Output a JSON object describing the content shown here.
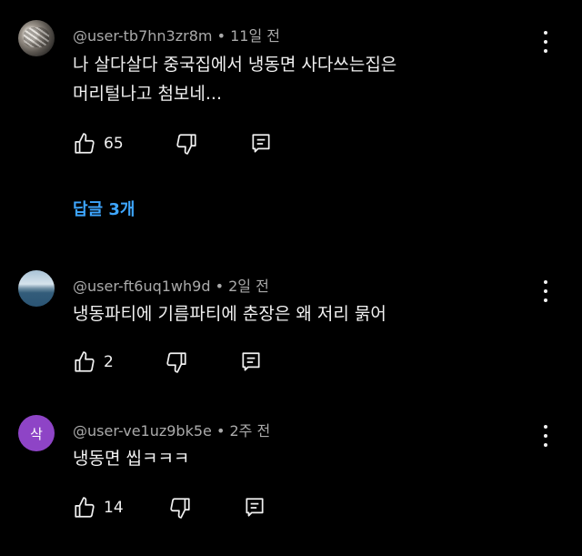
{
  "comments": [
    {
      "author": "@user-tb7hn3zr8m",
      "time": "11일 전",
      "lines": [
        "나 살다살다 중국집에서 냉동면 사다쓰는집은",
        "머리털나고 첨보네..."
      ],
      "likes": "65",
      "replies_label": "답글 3개"
    },
    {
      "author": "@user-ft6uq1wh9d",
      "time": "2일 전",
      "lines": [
        "냉동파티에 기름파티에 춘장은 왜 저리 묽어"
      ],
      "likes": "2"
    },
    {
      "author": "@user-ve1uz9bk5e",
      "time": "2주 전",
      "avatar_letter": "삭",
      "lines": [
        "냉동면 씹ㅋㅋㅋ"
      ],
      "likes": "14"
    }
  ],
  "icons": {
    "like": "thumbs-up-icon",
    "dislike": "thumbs-down-icon",
    "reply": "reply-comment-icon",
    "more": "more-vertical-icon"
  },
  "colors": {
    "background": "#000000",
    "link": "#3ea6ff",
    "avatar_purple": "#8e44c6"
  }
}
